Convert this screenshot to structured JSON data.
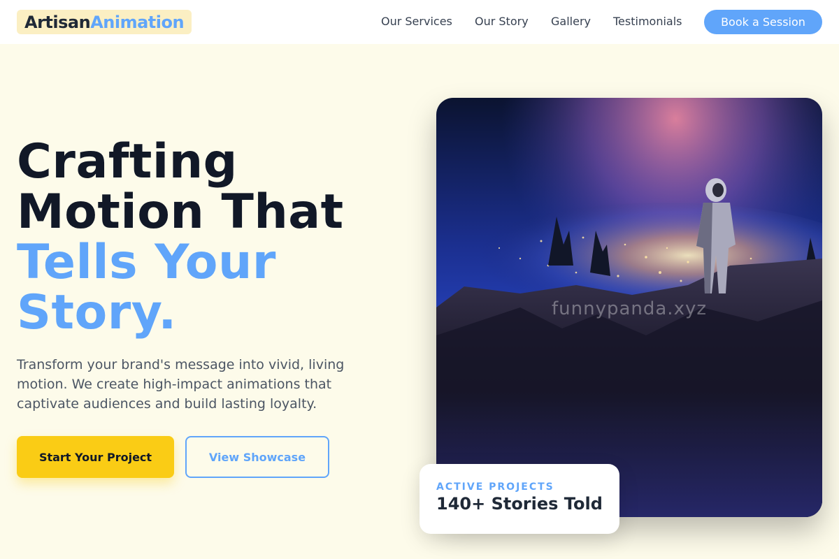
{
  "header": {
    "logo_part1": "Artisan",
    "logo_part2": "Animation",
    "nav": [
      {
        "label": "Our Services"
      },
      {
        "label": "Our Story"
      },
      {
        "label": "Gallery"
      },
      {
        "label": "Testimonials"
      }
    ],
    "cta_label": "Book a Session"
  },
  "hero": {
    "headline_line1": "Crafting",
    "headline_line2": "Motion That",
    "headline_line3": "Tells Your",
    "headline_line4": "Story.",
    "subtext": "Transform your brand's message into vivid, living motion. We create high-impact animations that captivate audiences and build lasting loyalty.",
    "primary_button": "Start Your Project",
    "secondary_button": "View Showcase"
  },
  "image": {
    "watermark": "funnypanda.xyz"
  },
  "stats": {
    "label": "ACTIVE PROJECTS",
    "value": "140+ Stories Told"
  },
  "colors": {
    "accent_blue": "#60a5fa",
    "accent_yellow": "#facc15",
    "page_bg": "#fdfbea",
    "heading_dark": "#111827"
  }
}
